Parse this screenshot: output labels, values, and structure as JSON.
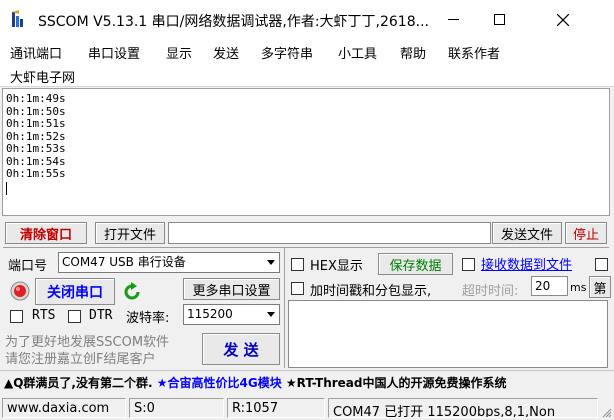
{
  "window": {
    "title": "SSCOM V5.13.1 串口/网络数据调试器,作者:大虾丁丁,2618..."
  },
  "menu": [
    "通讯端口",
    "串口设置",
    "显示",
    "发送",
    "多字符串",
    "小工具",
    "帮助",
    "联系作者"
  ],
  "menu2": "大虾电子网",
  "console": {
    "lines": [
      "0h:1m:49s",
      "0h:1m:50s",
      "0h:1m:51s",
      "0h:1m:52s",
      "0h:1m:53s",
      "0h:1m:54s",
      "0h:1m:55s"
    ]
  },
  "toolbar": {
    "clear": "清除窗口",
    "open_file": "打开文件",
    "send_file": "发送文件",
    "stop": "停止"
  },
  "port": {
    "port_label": "端口号",
    "port_value": "COM47 USB 串行设备",
    "close_port": "关闭串口",
    "more_settings": "更多串口设置",
    "rts": "RTS",
    "dtr": "DTR",
    "baud_label": "波特率:",
    "baud_value": "115200"
  },
  "options": {
    "hex_display": "HEX显示",
    "save_data": "保存数据",
    "recv_to_file": "接收数据到文件",
    "timestamp": "加时间戳和分包显示,",
    "timeout_label": "超时时间:",
    "timeout_value": "20",
    "timeout_unit": "ms",
    "frame_label": "第"
  },
  "promo": {
    "line1": "为了更好地发展SSCOM软件",
    "line2": "请您注册嘉立创F结尾客户"
  },
  "send_button": "发 送",
  "marquee": {
    "part1": "▲Q群满员了,没有第二个群.",
    "part2": "★合宙高性价比4G模块",
    "part3": "★RT-Thread中国人的开源免费操作系统"
  },
  "status": {
    "site": "www.daxia.com",
    "sent": "S:0",
    "received": "R:1057",
    "port_state": "COM47 已打开  115200bps,8,1,Non"
  },
  "colors": {
    "red_text": "#c00000",
    "blue_text": "#0000ff",
    "green_text": "#008000"
  }
}
